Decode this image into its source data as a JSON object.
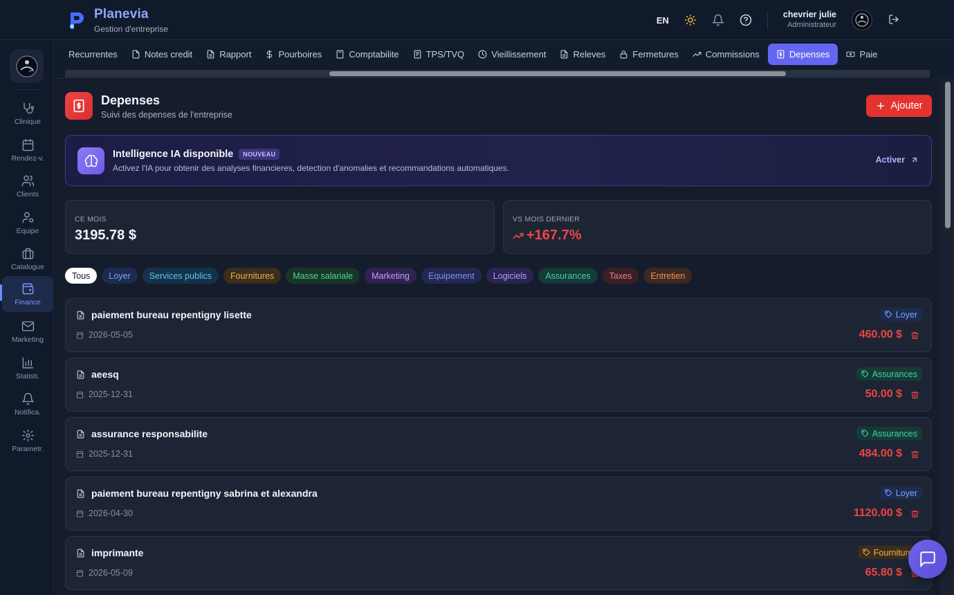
{
  "app": {
    "name": "Planevia",
    "subtitle": "Gestion d'entreprise"
  },
  "header": {
    "lang": "EN",
    "user_name": "chevrier julie",
    "user_role": "Administrateur"
  },
  "sidebar": {
    "items": [
      {
        "label": "Clinique",
        "icon": "stethoscope-icon"
      },
      {
        "label": "Rendez-v.",
        "icon": "calendar-icon"
      },
      {
        "label": "Clients",
        "icon": "users-icon"
      },
      {
        "label": "Equipe",
        "icon": "user-cog-icon"
      },
      {
        "label": "Catalogue",
        "icon": "briefcase-icon"
      },
      {
        "label": "Finance",
        "icon": "wallet-icon",
        "active": true
      },
      {
        "label": "Marketing",
        "icon": "mail-icon"
      },
      {
        "label": "Statisti.",
        "icon": "bar-chart-icon"
      },
      {
        "label": "Notifica.",
        "icon": "bell-icon"
      },
      {
        "label": "Parametr.",
        "icon": "gear-icon"
      }
    ]
  },
  "tabs": [
    {
      "label": "Recurrentes"
    },
    {
      "label": "Notes credit"
    },
    {
      "label": "Rapport"
    },
    {
      "label": "Pourboires"
    },
    {
      "label": "Comptabilite"
    },
    {
      "label": "TPS/TVQ"
    },
    {
      "label": "Vieillissement"
    },
    {
      "label": "Releves"
    },
    {
      "label": "Fermetures"
    },
    {
      "label": "Commissions"
    },
    {
      "label": "Depenses",
      "active": true
    },
    {
      "label": "Paie"
    }
  ],
  "page": {
    "title": "Depenses",
    "subtitle": "Suivi des depenses de l'entreprise",
    "add_label": "Ajouter"
  },
  "ai": {
    "title": "Intelligence IA disponible",
    "badge": "NOUVEAU",
    "description": "Activez l'IA pour obtenir des analyses financieres, detection d'anomalies et recommandations automatiques.",
    "action": "Activer"
  },
  "stats": {
    "month_label": "CE MOIS",
    "month_value": "3195.78 $",
    "vs_label": "VS MOIS DERNIER",
    "vs_value": "+167.7%"
  },
  "filters": [
    {
      "label": "Tous",
      "color": "#111827",
      "bg": "#ffffff"
    },
    {
      "label": "Loyer",
      "color": "#7ea6ff",
      "bg": "#1c2b4e"
    },
    {
      "label": "Services publics",
      "color": "#56c7e8",
      "bg": "#16324a"
    },
    {
      "label": "Fournitures",
      "color": "#f2b04a",
      "bg": "#3a2e1c"
    },
    {
      "label": "Masse salariale",
      "color": "#4fd49a",
      "bg": "#173628"
    },
    {
      "label": "Marketing",
      "color": "#c89cff",
      "bg": "#2f2350"
    },
    {
      "label": "Equipement",
      "color": "#7f8fff",
      "bg": "#22284e"
    },
    {
      "label": "Logiciels",
      "color": "#b59cff",
      "bg": "#2a2450"
    },
    {
      "label": "Assurances",
      "color": "#40d2b0",
      "bg": "#163a36"
    },
    {
      "label": "Taxes",
      "color": "#f07a7a",
      "bg": "#3a2024"
    },
    {
      "label": "Entretien",
      "color": "#f5915a",
      "bg": "#3b2820"
    }
  ],
  "expenses": [
    {
      "title": "paiement bureau repentigny lisette",
      "date": "2026-05-05",
      "category": "Loyer",
      "amount": "460.00 $",
      "tag_color": "#7ea6ff",
      "tag_bg": "#1c2b4e"
    },
    {
      "title": "aeesq",
      "date": "2025-12-31",
      "category": "Assurances",
      "amount": "50.00 $",
      "tag_color": "#40d2b0",
      "tag_bg": "#163a36"
    },
    {
      "title": "assurance responsabilite",
      "date": "2025-12-31",
      "category": "Assurances",
      "amount": "484.00 $",
      "tag_color": "#40d2b0",
      "tag_bg": "#163a36"
    },
    {
      "title": "paiement bureau repentigny sabrina et alexandra",
      "date": "2026-04-30",
      "category": "Loyer",
      "amount": "1120.00 $",
      "tag_color": "#7ea6ff",
      "tag_bg": "#1c2b4e"
    },
    {
      "title": "imprimante",
      "date": "2026-05-09",
      "category": "Fournitures",
      "amount": "65.80 $",
      "tag_color": "#f2b04a",
      "tag_bg": "#3a2e1c"
    }
  ]
}
